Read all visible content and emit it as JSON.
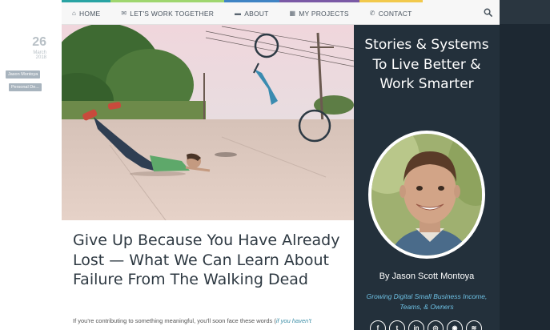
{
  "nav": {
    "items": [
      {
        "icon": "home-icon",
        "glyph": "⌂",
        "label": "HOME",
        "color": "#29a3a3"
      },
      {
        "icon": "chat-icon",
        "glyph": "✉",
        "label": "LET'S WORK TOGETHER",
        "color": "#9fd66f"
      },
      {
        "icon": "book-icon",
        "glyph": "▬",
        "label": "ABOUT",
        "color": "#3f84c4"
      },
      {
        "icon": "film-icon",
        "glyph": "▦",
        "label": "MY PROJECTS",
        "color": "#7b5aa6"
      },
      {
        "icon": "phone-icon",
        "glyph": "✆",
        "label": "CONTACT",
        "color": "#f2c94c"
      }
    ]
  },
  "post": {
    "day": "26",
    "month": "March",
    "year": "2018",
    "tags": [
      "Jason Montoya",
      "Personal De..."
    ],
    "title": "Give Up Because You Have Already Lost — What We Can Learn About Failure From The Walking Dead",
    "excerpt_start": "If you're contributing to something meaningful, you'll soon face these words (",
    "excerpt_link": "if you haven't"
  },
  "sidebar": {
    "tagline": "Stories & Systems To Live Better & Work Smarter",
    "author_name": "By Jason Scott Montoya",
    "author_sub": "Growing Digital Small Business Income, Teams, & Owners",
    "socials": [
      {
        "icon": "facebook-icon",
        "glyph": "f"
      },
      {
        "icon": "twitter-icon",
        "glyph": "t"
      },
      {
        "icon": "linkedin-icon",
        "glyph": "in"
      },
      {
        "icon": "instagram-icon",
        "glyph": "◎"
      },
      {
        "icon": "periscope-icon",
        "glyph": "◉"
      },
      {
        "icon": "rss-icon",
        "glyph": "≋"
      }
    ]
  },
  "colors": {
    "sidebar_bg": "#23303b",
    "accent_link": "#6ec1e4"
  }
}
